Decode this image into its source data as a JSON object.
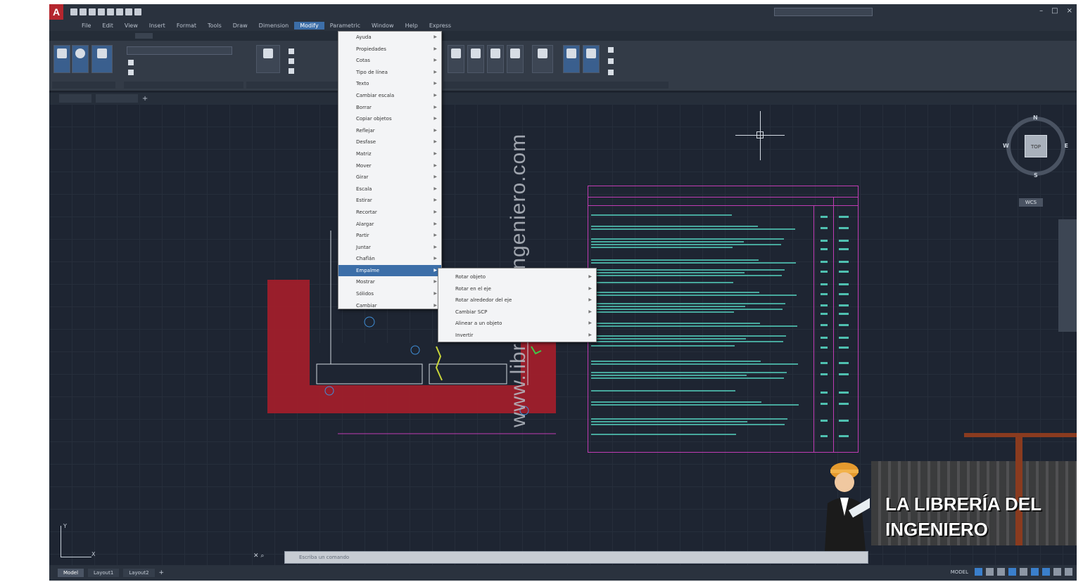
{
  "menubar": {
    "items": [
      "File",
      "Edit",
      "View",
      "Insert",
      "Format",
      "Tools",
      "Draw",
      "Dimension",
      "Modify",
      "Parametric",
      "Window",
      "Help",
      "Express"
    ],
    "active_index": 8
  },
  "dropdown_menu": {
    "items": [
      {
        "label": "Ayuda"
      },
      {
        "label": "Propiedades"
      },
      {
        "label": "Cotas"
      },
      {
        "label": "Tipo de línea"
      },
      {
        "label": "Texto"
      },
      {
        "label": "Cambiar escala"
      },
      {
        "label": "Borrar"
      },
      {
        "label": "Copiar objetos"
      },
      {
        "label": "Reflejar"
      },
      {
        "label": "Desfase"
      },
      {
        "label": "Matriz"
      },
      {
        "label": "Mover"
      },
      {
        "label": "Girar"
      },
      {
        "label": "Escala"
      },
      {
        "label": "Estirar"
      },
      {
        "label": "Recortar"
      },
      {
        "label": "Alargar"
      },
      {
        "label": "Partir"
      },
      {
        "label": "Juntar"
      },
      {
        "label": "Chaflán"
      },
      {
        "label": "Empalme"
      },
      {
        "label": "Mostrar"
      },
      {
        "label": "Sólidos"
      },
      {
        "label": "Cambiar"
      }
    ],
    "selected_index": 20
  },
  "submenu": {
    "items": [
      "Rotar objeto",
      "Rotar en el eje",
      "Rotar alrededor del eje",
      "Cambiar SCP",
      "Alinear a un objeto",
      "Invertir"
    ]
  },
  "command_line": {
    "placeholder": "Escriba un comando"
  },
  "statusbar": {
    "layout_tabs": [
      "Model",
      "Layout1",
      "Layout2"
    ],
    "active_tab": 0,
    "model_label": "MODEL"
  },
  "viewcube": {
    "face": "TOP",
    "n": "N",
    "s": "S",
    "e": "E",
    "w": "W",
    "wcs": "WCS"
  },
  "ucs": {
    "x": "X",
    "y": "Y"
  },
  "watermark": "www.libreriadelingeniero.com",
  "brand": {
    "line1": "LA LIBRERÍA DEL",
    "line2": "INGENIERO"
  },
  "colors": {
    "accent": "#3c6ea8",
    "drawing_red": "#a61e2a",
    "table_magenta": "#c03cb4",
    "text_cyan": "#4fc0b0",
    "dim_green": "#3fc84a"
  }
}
